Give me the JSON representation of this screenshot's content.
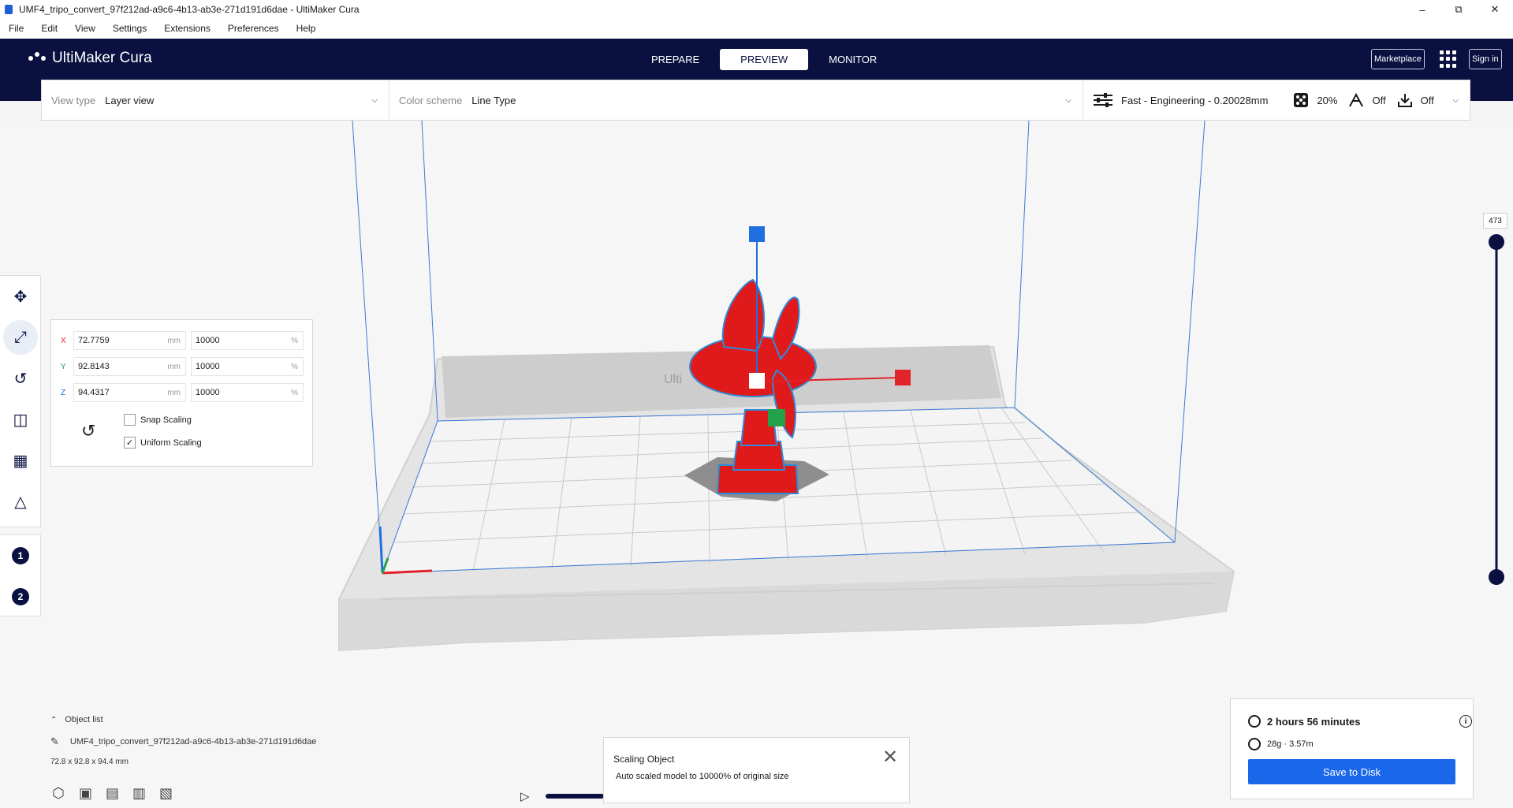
{
  "window": {
    "title": "UMF4_tripo_convert_97f212ad-a9c6-4b13-ab3e-271d191d6dae - UltiMaker Cura",
    "minimize": "–",
    "maximize": "⧉",
    "close": "✕"
  },
  "menu": [
    "File",
    "Edit",
    "View",
    "Settings",
    "Extensions",
    "Preferences",
    "Help"
  ],
  "header": {
    "logo": "UltiMaker Cura",
    "tabs": [
      "PREPARE",
      "PREVIEW",
      "MONITOR"
    ],
    "active_tab": "PREVIEW",
    "marketplace": "Marketplace",
    "sign_in": "Sign in"
  },
  "settings_bar": {
    "view_type_label": "View type",
    "view_type_value": "Layer view",
    "color_scheme_label": "Color scheme",
    "color_scheme_value": "Line Type",
    "profile": "Fast - Engineering - 0.20028mm",
    "infill": "20%",
    "support": "Off",
    "adhesion": "Off"
  },
  "scale_panel": {
    "x_label": "X",
    "x_mm": "72.7759",
    "x_pct": "10000",
    "y_label": "Y",
    "y_mm": "92.8143",
    "y_pct": "10000",
    "z_label": "Z",
    "z_mm": "94.4317",
    "z_pct": "10000",
    "unit_mm": "mm",
    "unit_pct": "%",
    "snap_scaling": "Snap Scaling",
    "uniform_scaling": "Uniform Scaling",
    "snap_checked": false,
    "uniform_checked": true
  },
  "layer_slider": {
    "value": "473"
  },
  "object_list": {
    "title": "Object list",
    "item": "UMF4_tripo_convert_97f212ad-a9c6-4b13-ab3e-271d191d6dae",
    "dimensions": "72.8 x 92.8 x 94.4 mm"
  },
  "toast": {
    "title": "Scaling Object",
    "message": "Auto scaled model to 10000% of original size"
  },
  "print_info": {
    "time": "2 hours 56 minutes",
    "material": "28g · 3.57m",
    "save_button": "Save to Disk"
  },
  "build_plate_text": "Ulti",
  "colors": {
    "header_bg": "#0a1140",
    "accent": "#1b67ea",
    "model": "#e01a1a",
    "axis_x": "#e2232a",
    "axis_y": "#22a34a",
    "axis_z": "#1f6fe0"
  },
  "icons": [
    "move-icon",
    "scale-icon",
    "rotate-icon",
    "mirror-icon",
    "per-model-settings-icon",
    "support-blocker-icon",
    "clock-icon",
    "spool-icon",
    "info-icon",
    "close-icon",
    "play-icon",
    "pencil-icon",
    "view-3d-icon",
    "view-front-icon",
    "view-top-icon",
    "view-left-icon",
    "view-right-icon"
  ]
}
